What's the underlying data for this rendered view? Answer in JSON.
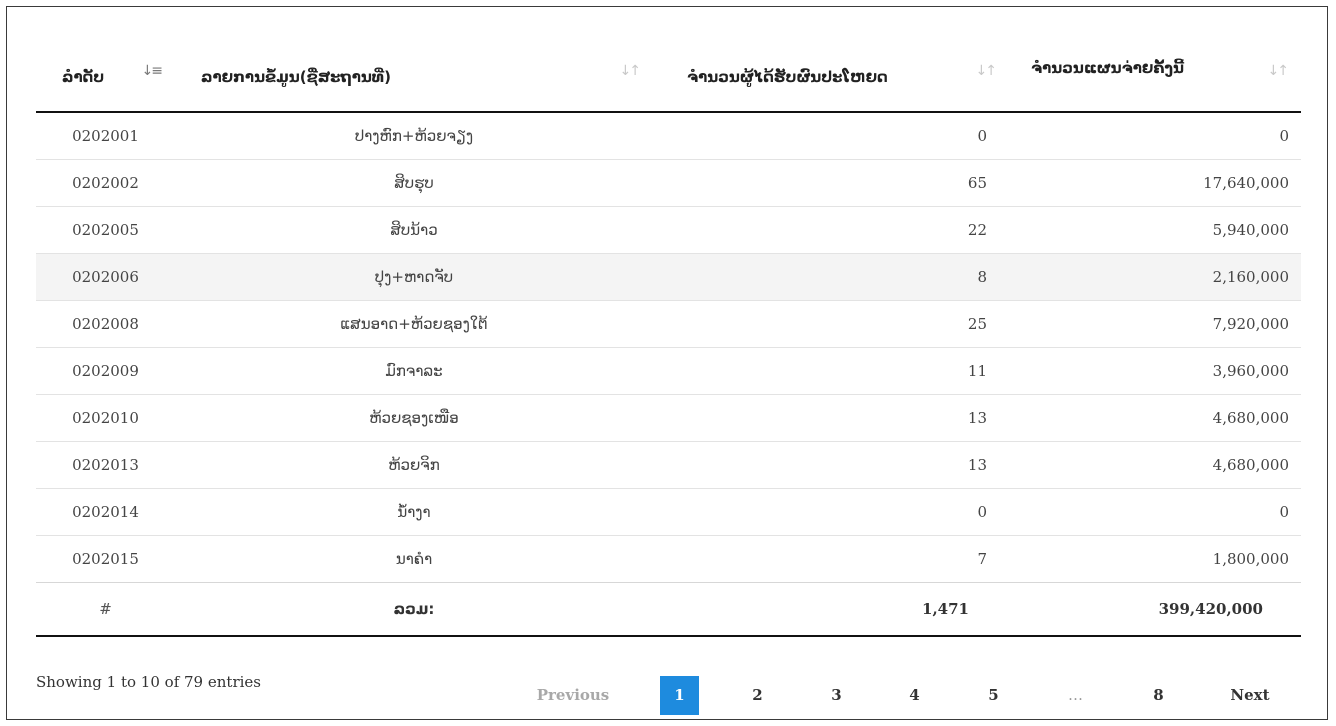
{
  "table": {
    "headers": [
      "ລຳດັບ",
      "ລາຍການຂໍ້ມູນ(ຊື່ສະຖານທີ່)",
      "ຈຳນວນຜູ້ໄດ້ຮັບຜົນປະໂຫຍດ",
      "ຈຳນວນແຜນຈ່າຍຄັ້ງນີ້"
    ],
    "sort_icons": {
      "active": "sort-amount-down-icon",
      "inactive": "sort-both-icon"
    },
    "rows": [
      {
        "id": "0202001",
        "name": "ປາງຫົກ+ຫ້ວຍຈຽງ",
        "beneficiaries": "0",
        "planned": "0"
      },
      {
        "id": "0202002",
        "name": "ສິບຮຸບ",
        "beneficiaries": "65",
        "planned": "17,640,000"
      },
      {
        "id": "0202005",
        "name": "ສິບນ້າວ",
        "beneficiaries": "22",
        "planned": "5,940,000"
      },
      {
        "id": "0202006",
        "name": "ປຸງ+ຫາດຈັບ",
        "beneficiaries": "8",
        "planned": "2,160,000"
      },
      {
        "id": "0202008",
        "name": "ແສນອາດ+ຫ້ວຍຊອງໃຕ້",
        "beneficiaries": "25",
        "planned": "7,920,000"
      },
      {
        "id": "0202009",
        "name": "ມົກຈາລະ",
        "beneficiaries": "11",
        "planned": "3,960,000"
      },
      {
        "id": "0202010",
        "name": "ຫ້ວຍຊອງເໜືອ",
        "beneficiaries": "13",
        "planned": "4,680,000"
      },
      {
        "id": "0202013",
        "name": "ຫ້ວຍຈິກ",
        "beneficiaries": "13",
        "planned": "4,680,000"
      },
      {
        "id": "0202014",
        "name": "ນ້ຳງາ",
        "beneficiaries": "0",
        "planned": "0"
      },
      {
        "id": "0202015",
        "name": "ນາຄຳ",
        "beneficiaries": "7",
        "planned": "1,800,000"
      }
    ],
    "footer": {
      "hash": "#",
      "label": "ລວມ:",
      "total_beneficiaries": "1,471",
      "total_planned": "399,420,000"
    }
  },
  "info": {
    "prefix": "Showing ",
    "from": "1",
    "to_word": " to ",
    "to": "10",
    "of_word": " of ",
    "total": "79",
    "suffix": " entries"
  },
  "pagination": {
    "previous": "Previous",
    "pages": [
      "1",
      "2",
      "3",
      "4",
      "5"
    ],
    "ellipsis": "…",
    "last": "8",
    "next": "Next",
    "current_color": "#1e8bde"
  }
}
